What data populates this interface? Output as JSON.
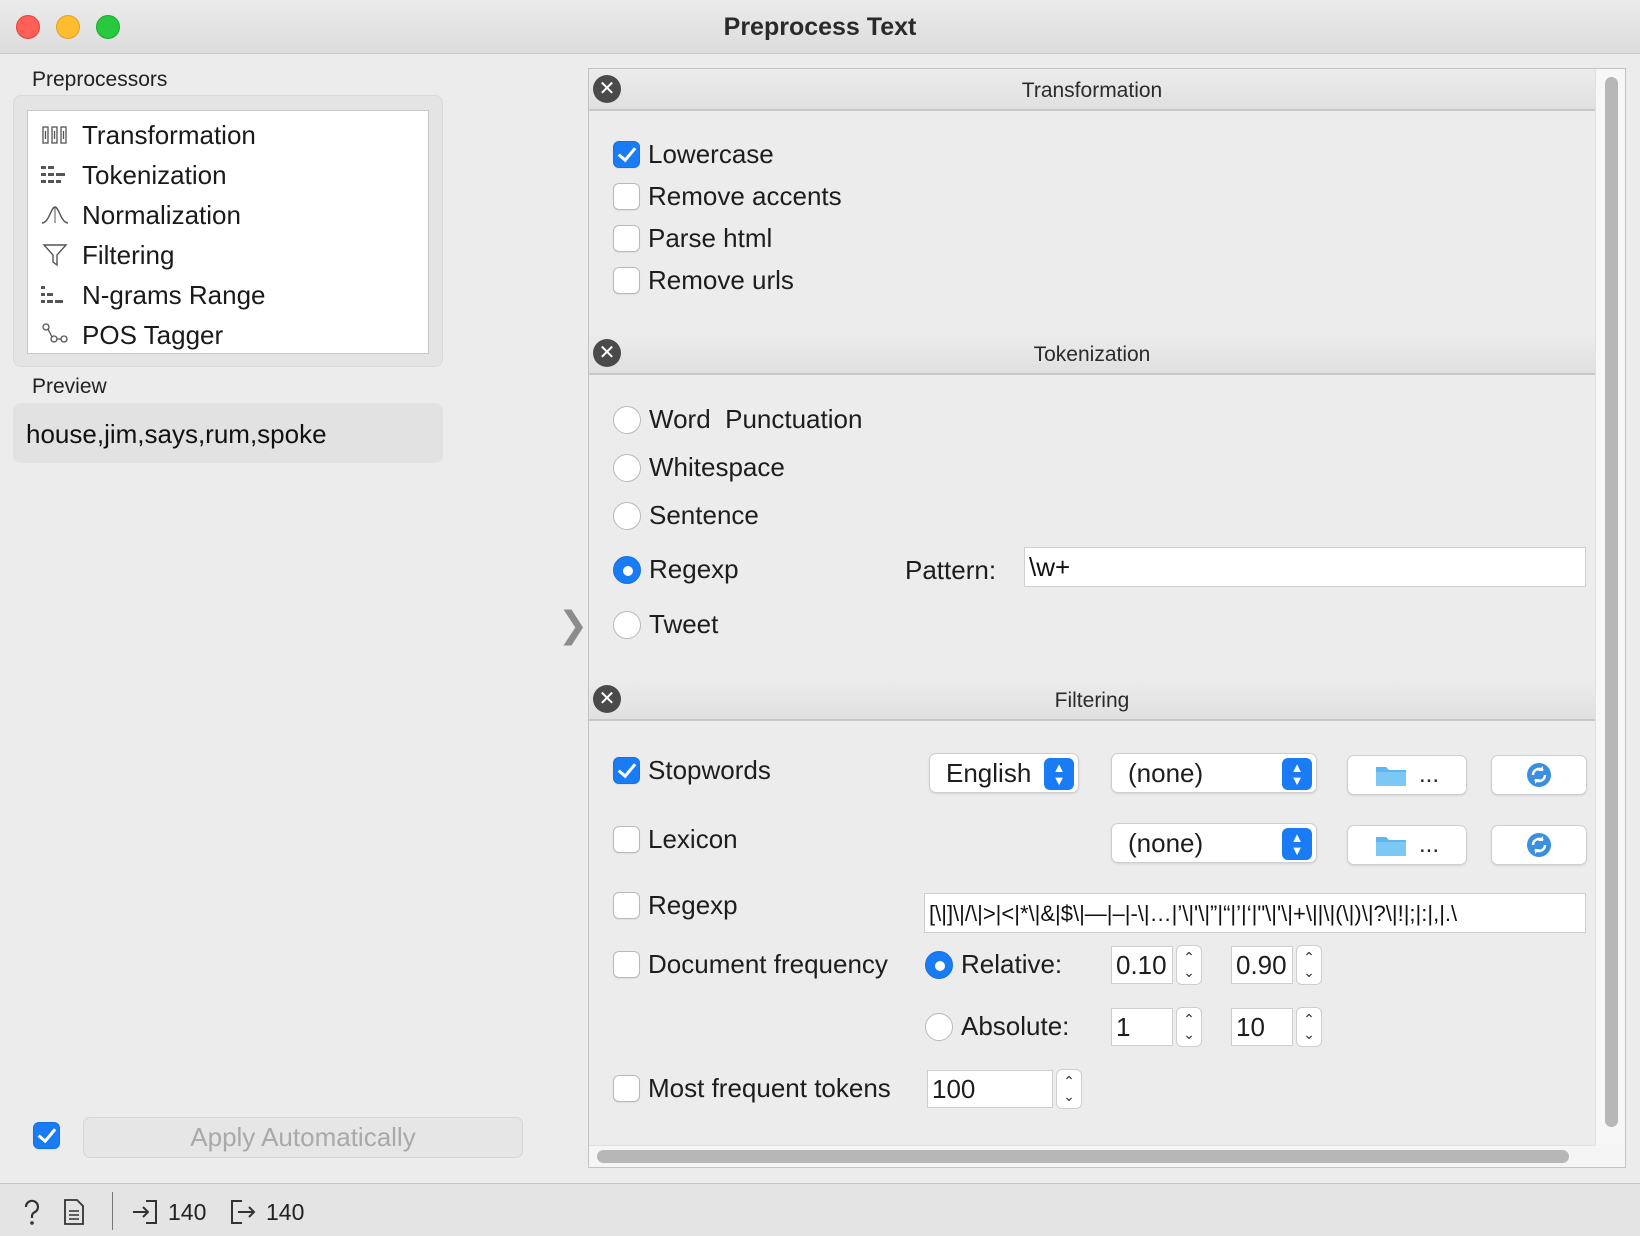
{
  "window": {
    "title": "Preprocess Text"
  },
  "left": {
    "preprocessors_label": "Preprocessors",
    "preprocessors": [
      {
        "label": "Transformation",
        "icon": "transformation-icon"
      },
      {
        "label": "Tokenization",
        "icon": "tokenization-icon"
      },
      {
        "label": "Normalization",
        "icon": "normalization-icon"
      },
      {
        "label": "Filtering",
        "icon": "filter-icon"
      },
      {
        "label": "N-grams Range",
        "icon": "ngrams-icon"
      },
      {
        "label": "POS Tagger",
        "icon": "pos-tagger-icon"
      }
    ],
    "preview_label": "Preview",
    "preview_text": "house,jim,says,rum,spoke",
    "apply_checked": true,
    "apply_label": "Apply Automatically"
  },
  "status": {
    "input_count": "140",
    "output_count": "140"
  },
  "transformation": {
    "title": "Transformation",
    "options": [
      {
        "label": "Lowercase",
        "checked": true
      },
      {
        "label": "Remove accents",
        "checked": false
      },
      {
        "label": "Parse html",
        "checked": false
      },
      {
        "label": "Remove urls",
        "checked": false
      }
    ]
  },
  "tokenization": {
    "title": "Tokenization",
    "options": [
      {
        "label": "Word  Punctuation",
        "selected": false
      },
      {
        "label": "Whitespace",
        "selected": false
      },
      {
        "label": "Sentence",
        "selected": false
      },
      {
        "label": "Regexp",
        "selected": true
      },
      {
        "label": "Tweet",
        "selected": false
      }
    ],
    "pattern_label": "Pattern:",
    "pattern_value": "\\w+"
  },
  "filtering": {
    "title": "Filtering",
    "stopwords": {
      "label": "Stopwords",
      "checked": true,
      "language": "English",
      "file": "(none)"
    },
    "lexicon": {
      "label": "Lexicon",
      "checked": false,
      "file": "(none)"
    },
    "browse_label": "...",
    "regexp": {
      "label": "Regexp",
      "checked": false,
      "value": "\\.|,|:|;|!|\\?|\\(|\\)|\\||\\+|\\'|\\\"|‘|’|“|”|\\'|\\’|…|\\-|–|—|\\$|&|\\*|>|<|\\/|\\[|\\]"
    },
    "docfreq": {
      "label": "Document frequency",
      "checked": false,
      "relative_label": "Relative:",
      "relative_selected": true,
      "rel_min": "0.10",
      "rel_max": "0.90",
      "absolute_label": "Absolute:",
      "abs_min": "1",
      "abs_max": "10"
    },
    "most_frequent": {
      "label": "Most frequent tokens",
      "checked": false,
      "value": "100"
    }
  },
  "colors": {
    "accent": "#1a7cf5",
    "close_red": "#fe5f57",
    "min_yellow": "#febc2e",
    "max_green": "#28c840"
  }
}
